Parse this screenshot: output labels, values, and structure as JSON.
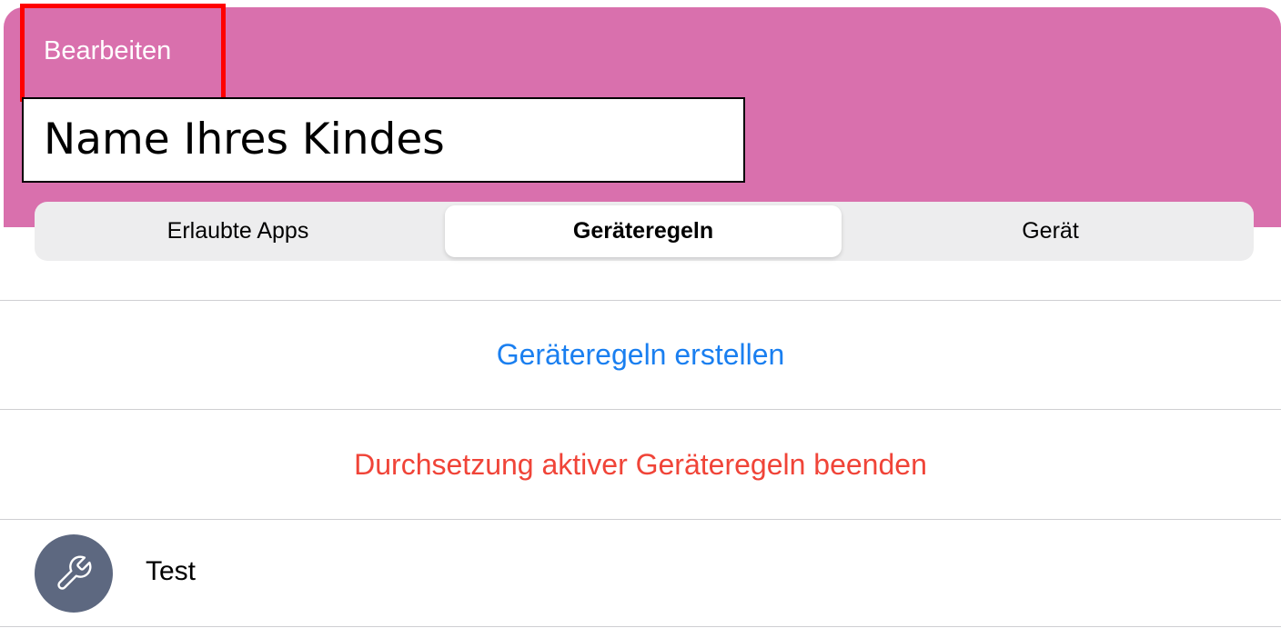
{
  "colors": {
    "header_bg": "#d970ad",
    "highlight": "#ff0000",
    "action_blue": "#1a7ff0",
    "action_red": "#f04438",
    "avatar_bg": "#5d6880"
  },
  "header": {
    "edit_label": "Bearbeiten",
    "child_name_label": "Name Ihres Kindes"
  },
  "tabs": [
    {
      "label": "Erlaubte Apps",
      "selected": false
    },
    {
      "label": "Geräteregeln",
      "selected": true
    },
    {
      "label": "Gerät",
      "selected": false
    }
  ],
  "actions": {
    "create_rules": "Geräteregeln erstellen",
    "stop_enforcement": "Durchsetzung aktiver Geräteregeln beenden"
  },
  "rules": [
    {
      "label": "Test",
      "icon": "wrench-icon"
    }
  ]
}
